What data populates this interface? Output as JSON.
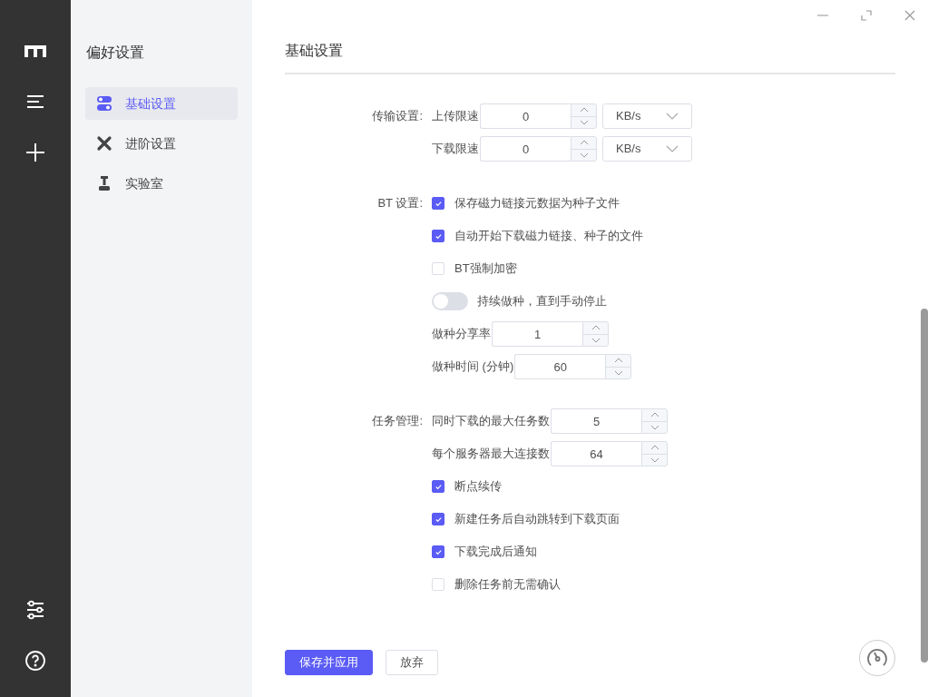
{
  "sidebar": {
    "title": "偏好设置",
    "items": [
      {
        "kind": "basic",
        "label": "基础设置",
        "selected": true
      },
      {
        "kind": "advanced",
        "label": "进阶设置",
        "selected": false
      },
      {
        "kind": "lab",
        "label": "实验室",
        "selected": false
      }
    ]
  },
  "page": {
    "title": "基础设置",
    "sections": [
      {
        "label": "传输设置:",
        "rows": [
          {
            "kind": "number",
            "label": "上传限速",
            "value": "0",
            "unit": "KB/s"
          },
          {
            "kind": "number",
            "label": "下载限速",
            "value": "0",
            "unit": "KB/s"
          }
        ]
      },
      {
        "label": "BT 设置:",
        "rows": [
          {
            "kind": "checkbox",
            "label": "保存磁力链接元数据为种子文件",
            "checked": true
          },
          {
            "kind": "checkbox",
            "label": "自动开始下载磁力链接、种子的文件",
            "checked": true
          },
          {
            "kind": "checkbox",
            "label": "BT强制加密",
            "checked": false
          },
          {
            "kind": "switch",
            "label": "持续做种，直到手动停止",
            "on": false
          },
          {
            "kind": "number",
            "label": "做种分享率",
            "value": "1"
          },
          {
            "kind": "number",
            "label": "做种时间 (分钟)",
            "value": "60"
          }
        ]
      },
      {
        "label": "任务管理:",
        "rows": [
          {
            "kind": "number",
            "label": "同时下载的最大任务数",
            "value": "5"
          },
          {
            "kind": "number",
            "label": "每个服务器最大连接数",
            "value": "64"
          },
          {
            "kind": "checkbox",
            "label": "断点续传",
            "checked": true
          },
          {
            "kind": "checkbox",
            "label": "新建任务后自动跳转到下载页面",
            "checked": true
          },
          {
            "kind": "checkbox",
            "label": "下载完成后通知",
            "checked": true
          },
          {
            "kind": "checkbox",
            "label": "删除任务前无需确认",
            "checked": false
          }
        ]
      }
    ],
    "buttons": [
      {
        "kind": "primary",
        "label": "保存并应用"
      },
      {
        "kind": "secondary",
        "label": "放弃"
      }
    ]
  }
}
